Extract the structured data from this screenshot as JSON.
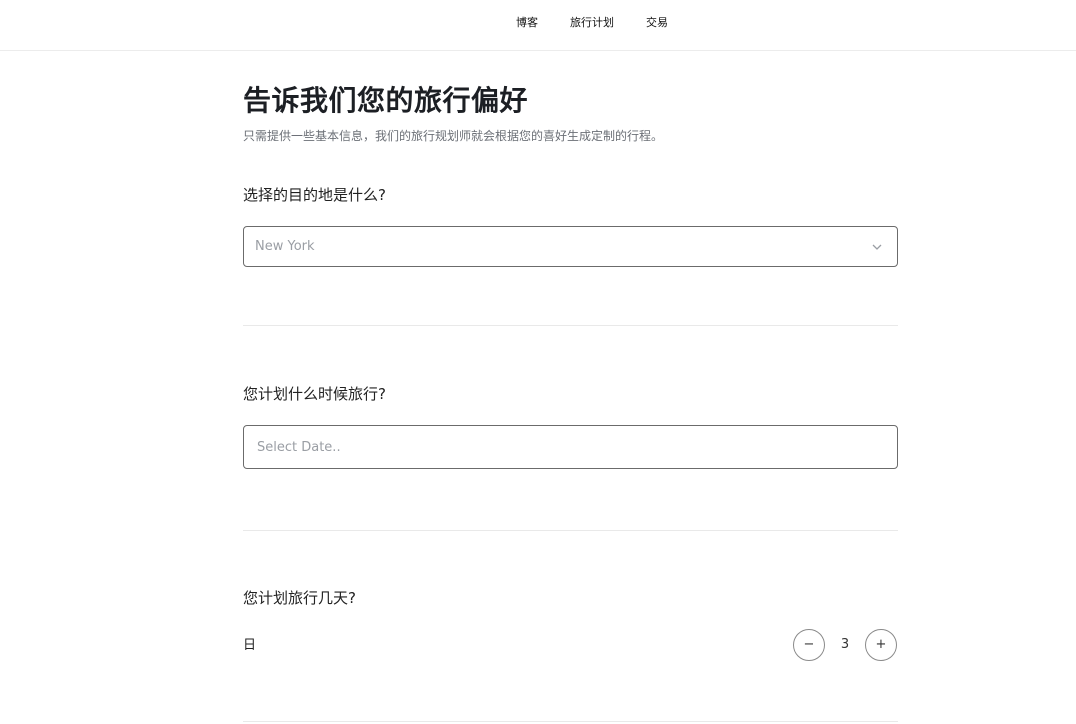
{
  "nav": {
    "links": [
      "博客",
      "旅行计划",
      "交易"
    ]
  },
  "header": {
    "title": "告诉我们您的旅行偏好",
    "subtitle": "只需提供一些基本信息，我们的旅行规划师就会根据您的喜好生成定制的行程。"
  },
  "destination": {
    "question": "选择的目的地是什么?",
    "selected": "New York",
    "icon": "chevron-down-icon"
  },
  "date": {
    "question": "您计划什么时候旅行?",
    "placeholder": "Select Date.."
  },
  "duration": {
    "question": "您计划旅行几天?",
    "unit_label": "日",
    "value": "3",
    "minus_label": "−",
    "plus_label": "+"
  },
  "colors": {
    "border": "#6b6b6b",
    "divider": "#e9e9e9",
    "title": "#1c1f24",
    "muted": "#9a9ea4"
  }
}
